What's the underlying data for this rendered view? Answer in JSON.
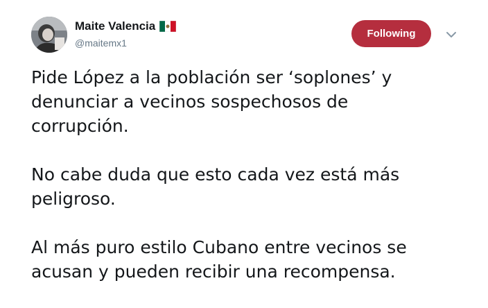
{
  "tweet": {
    "author": {
      "display_name": "Maite Valencia",
      "flag_icon": "mexico-flag-emoji",
      "username": "@maitemx1"
    },
    "follow_button": {
      "label": "Following",
      "color": "#b52e3e"
    },
    "menu_icon": "chevron-down-icon",
    "text_paragraphs": [
      "Pide López  a la población ser ‘soplones’ y\ndenunciar a vecinos sospechosos de\ncorrupción.",
      "No cabe duda que esto cada vez está más\npeligroso.",
      "Al más puro estilo Cubano entre vecinos se\nacusan y pueden recibir una recompensa."
    ]
  }
}
